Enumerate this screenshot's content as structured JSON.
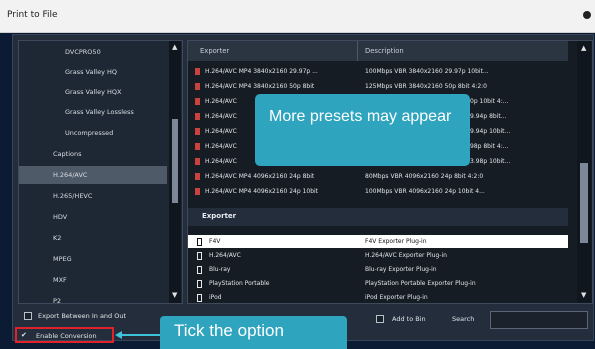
{
  "window": {
    "title": "Print to File"
  },
  "left_list": {
    "items": [
      {
        "label": "DVCPRO50",
        "level": "sub",
        "selected": false
      },
      {
        "label": "Grass Valley HQ",
        "level": "sub",
        "selected": false
      },
      {
        "label": "Grass Valley HQX",
        "level": "sub",
        "selected": false
      },
      {
        "label": "Grass Valley Lossless",
        "level": "sub",
        "selected": false
      },
      {
        "label": "Uncompressed",
        "level": "sub",
        "selected": false
      },
      {
        "label": "Captions",
        "level": "top",
        "selected": false
      },
      {
        "label": "H.264/AVC",
        "level": "top",
        "selected": true
      },
      {
        "label": "H.265/HEVC",
        "level": "top",
        "selected": false
      },
      {
        "label": "HDV",
        "level": "top",
        "selected": false
      },
      {
        "label": "K2",
        "level": "top",
        "selected": false
      },
      {
        "label": "MPEG",
        "level": "top",
        "selected": false
      },
      {
        "label": "MXF",
        "level": "top",
        "selected": false
      },
      {
        "label": "P2",
        "level": "top",
        "selected": false
      }
    ]
  },
  "presets": {
    "headers": {
      "exporter": "Exporter",
      "description": "Description"
    },
    "rows": [
      {
        "exporter": "H.264/AVC MP4 3840x2160 29.97p ...",
        "description": "100Mbps VBR 3840x2160 29.97p 10bit..."
      },
      {
        "exporter": "H.264/AVC MP4 3840x2160 50p 8bit",
        "description": "125Mbps VBR 3840x2160 50p 8bit 4:2:0"
      },
      {
        "exporter": "H.264/AVC",
        "description": "0p 10bit 4:..."
      },
      {
        "exporter": "H.264/AVC",
        "description": "9.94p 8bit..."
      },
      {
        "exporter": "H.264/AVC",
        "description": "9.94p 10bit..."
      },
      {
        "exporter": "H.264/AVC",
        "description": "98p 8bit 4:..."
      },
      {
        "exporter": "H.264/AVC",
        "description": "3.98p 10bit..."
      },
      {
        "exporter": "H.264/AVC MP4 4096x2160 24p 8bit",
        "description": "80Mbps VBR 4096x2160 24p 8bit 4:2:0"
      },
      {
        "exporter": "H.264/AVC MP4 4096x2160 24p 10bit",
        "description": "100Mbps VBR 4096x2160 24p 10bit 4..."
      }
    ]
  },
  "exporters": {
    "section_label": "Exporter",
    "rows": [
      {
        "name": "F4V",
        "description": "F4V Exporter Plug-in",
        "selected": true
      },
      {
        "name": "H.264/AVC",
        "description": "H.264/AVC Exporter Plug-in",
        "selected": false
      },
      {
        "name": "Blu-ray",
        "description": "Blu-ray Exporter Plug-in",
        "selected": false
      },
      {
        "name": "PlayStation Portable",
        "description": "PlayStation Portable Exporter Plug-in",
        "selected": false
      },
      {
        "name": "iPod",
        "description": "iPod Exporter Plug-in",
        "selected": false
      }
    ]
  },
  "callouts": {
    "presets_tip": "More presets may appear",
    "tick_tip": "Tick the option"
  },
  "bottom": {
    "export_between": "Export Between In and Out",
    "enable_conversion": "Enable Conversion",
    "enable_conversion_checked": true,
    "add_to_bin": "Add to Bin",
    "search_label": "Search",
    "search_value": ""
  },
  "colors": {
    "highlight_red": "#e0232a",
    "callout_teal": "#2ea4bf"
  },
  "icons": {
    "scroll_up": "triangle-up",
    "scroll_down": "triangle-down"
  }
}
